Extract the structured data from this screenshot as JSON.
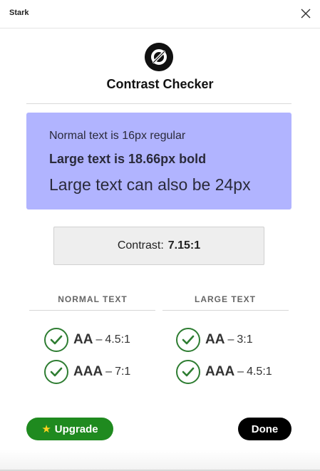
{
  "window": {
    "app_title": "Stark",
    "close_icon": "close-icon"
  },
  "header": {
    "logo_icon": "stark-logo-icon",
    "title": "Contrast Checker"
  },
  "preview": {
    "background_color": "#b1b4ff",
    "normal_text": "Normal text is 16px regular",
    "large_bold_text": "Large text is 18.66px bold",
    "large_text": "Large text can also be 24px"
  },
  "contrast": {
    "label": "Contrast:",
    "value": "7.15:1"
  },
  "results": {
    "normal": {
      "heading": "NORMAL TEXT",
      "items": [
        {
          "level": "AA",
          "separator": "–",
          "ratio": "4.5:1",
          "passed": true
        },
        {
          "level": "AAA",
          "separator": "–",
          "ratio": "7:1",
          "passed": true
        }
      ]
    },
    "large": {
      "heading": "LARGE TEXT",
      "items": [
        {
          "level": "AA",
          "separator": "–",
          "ratio": "3:1",
          "passed": true
        },
        {
          "level": "AAA",
          "separator": "–",
          "ratio": "4.5:1",
          "passed": true
        }
      ]
    },
    "pass_color": "#2e7d32"
  },
  "footer": {
    "upgrade_icon": "star-icon",
    "upgrade_label": "Upgrade",
    "upgrade_color": "#1f8a1f",
    "done_label": "Done"
  }
}
